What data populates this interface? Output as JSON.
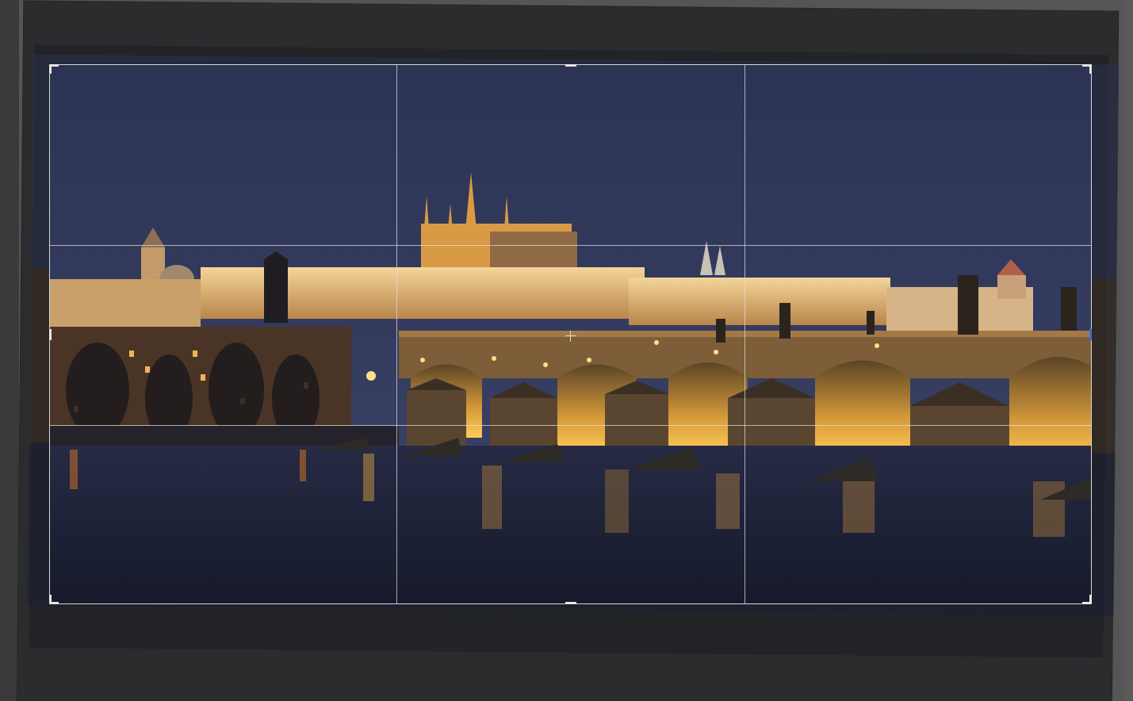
{
  "app": {
    "mode": "crop",
    "tool": "crop-and-straighten",
    "overlay": "rule-of-thirds",
    "straighten_angle_deg": 0.55
  },
  "image": {
    "subject": "night-city-river-bridge-castle",
    "colors": {
      "sky_top": "#2c3354",
      "sky_bottom": "#3a4266",
      "light_warm": "#f0b24a",
      "building_lit": "#e9c585",
      "water": "#1c2136",
      "stone": "#6b5236"
    }
  },
  "crop": {
    "border_color": "#d8d8d8",
    "handle_color": "#e8e6df",
    "active_handle_color": "#3b6fd6"
  }
}
